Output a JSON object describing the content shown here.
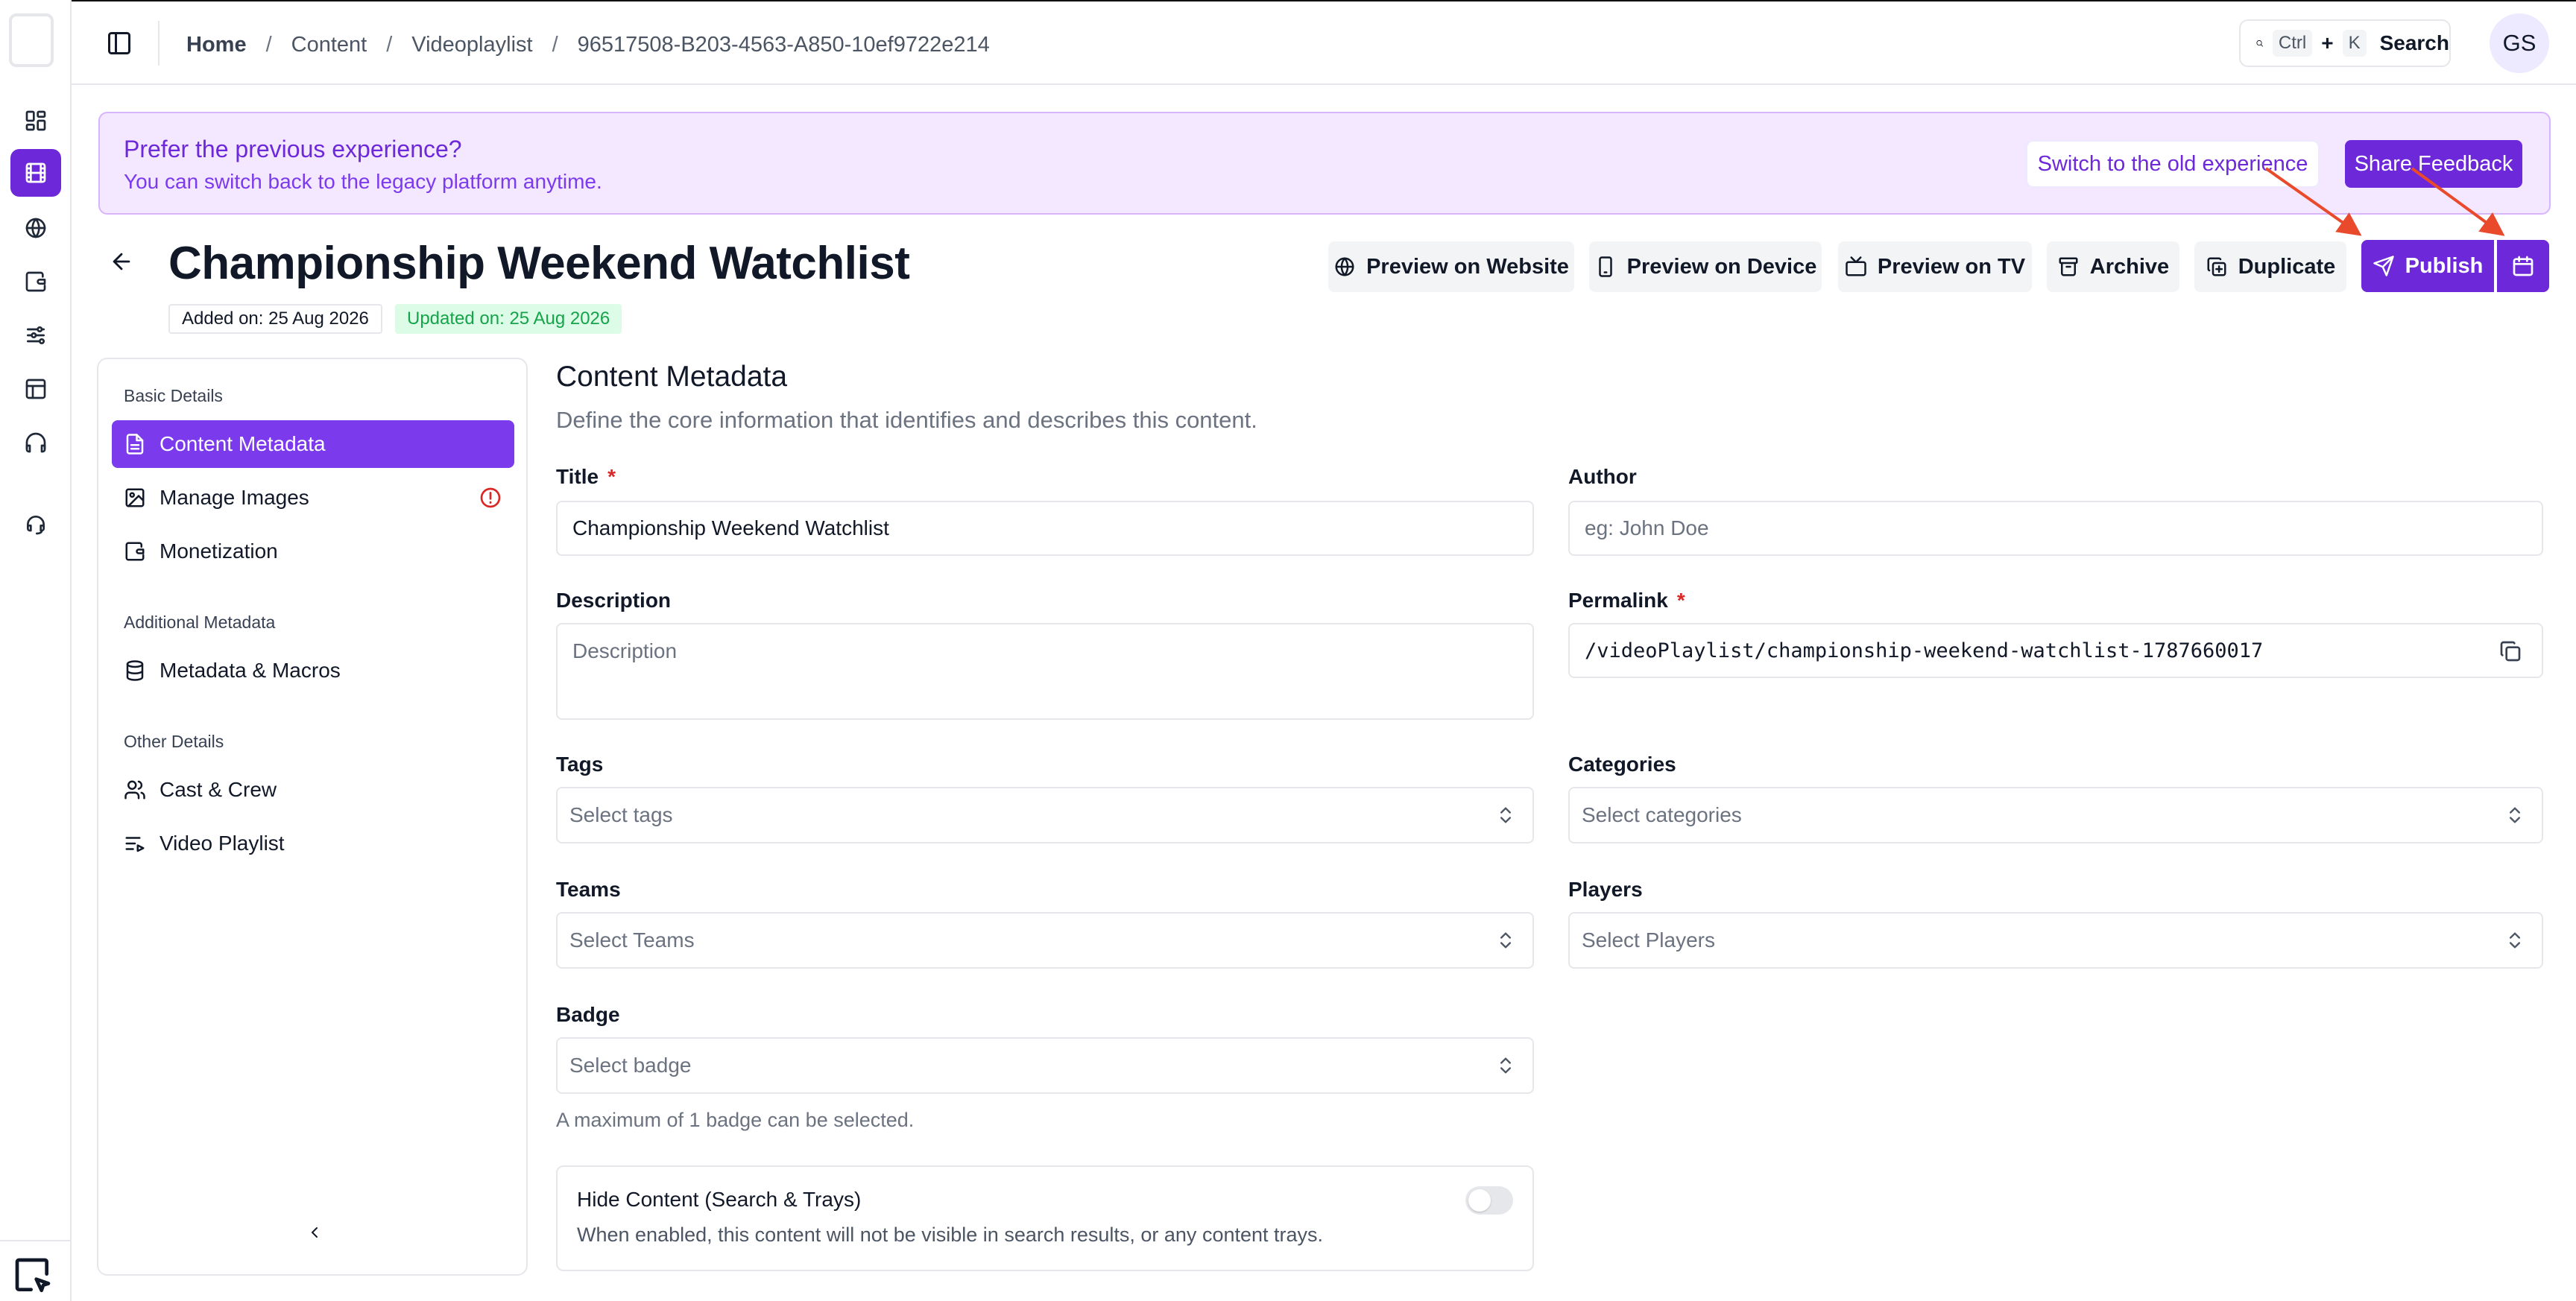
{
  "header": {
    "breadcrumb": [
      "Home",
      "Content",
      "Videoplaylist",
      "96517508-B203-4563-A850-10ef9722e214"
    ],
    "search": {
      "shortcut_ctrl": "Ctrl",
      "shortcut_plus": "+",
      "shortcut_key": "K",
      "label": "Search"
    },
    "user_initials": "GS"
  },
  "banner": {
    "title": "Prefer the previous experience?",
    "subtitle": "You can switch back to the legacy platform anytime.",
    "switch_label": "Switch to the old experience",
    "feedback_label": "Share Feedback"
  },
  "page": {
    "title": "Championship Weekend Watchlist",
    "added_on": "Added on: 25 Aug 2026",
    "updated_on": "Updated on: 25 Aug 2026",
    "actions": {
      "preview_website": "Preview on Website",
      "preview_device": "Preview on Device",
      "preview_tv": "Preview on TV",
      "archive": "Archive",
      "duplicate": "Duplicate",
      "publish": "Publish"
    }
  },
  "nav": {
    "groups": [
      {
        "title": "Basic Details",
        "items": [
          "Content Metadata",
          "Manage Images",
          "Monetization"
        ]
      },
      {
        "title": "Additional Metadata",
        "items": [
          "Metadata & Macros"
        ]
      },
      {
        "title": "Other Details",
        "items": [
          "Cast & Crew",
          "Video Playlist"
        ]
      }
    ]
  },
  "form": {
    "section_title": "Content Metadata",
    "section_subtitle": "Define the core information that identifies and describes this content.",
    "title": {
      "label": "Title",
      "required": "*",
      "value": "Championship Weekend Watchlist"
    },
    "author": {
      "label": "Author",
      "placeholder": "eg: John Doe"
    },
    "description": {
      "label": "Description",
      "placeholder": "Description"
    },
    "permalink": {
      "label": "Permalink",
      "required": "*",
      "value": "/videoPlaylist/championship-weekend-watchlist-1787660017"
    },
    "tags": {
      "label": "Tags",
      "placeholder": "Select tags"
    },
    "categories": {
      "label": "Categories",
      "placeholder": "Select categories"
    },
    "teams": {
      "label": "Teams",
      "placeholder": "Select Teams"
    },
    "players": {
      "label": "Players",
      "placeholder": "Select Players"
    },
    "badge": {
      "label": "Badge",
      "placeholder": "Select badge",
      "hint": "A maximum of 1 badge can be selected."
    },
    "hide_content": {
      "title": "Hide Content (Search & Trays)",
      "description": "When enabled, this content will not be visible in search results, or any content trays.",
      "enabled": false
    }
  },
  "colors": {
    "accent": "#6d28d9",
    "banner_bg": "#f3e8ff",
    "annotation_arrow": "#ea4a2c",
    "required": "#dc2626",
    "updated_badge": "#dcfce7"
  }
}
